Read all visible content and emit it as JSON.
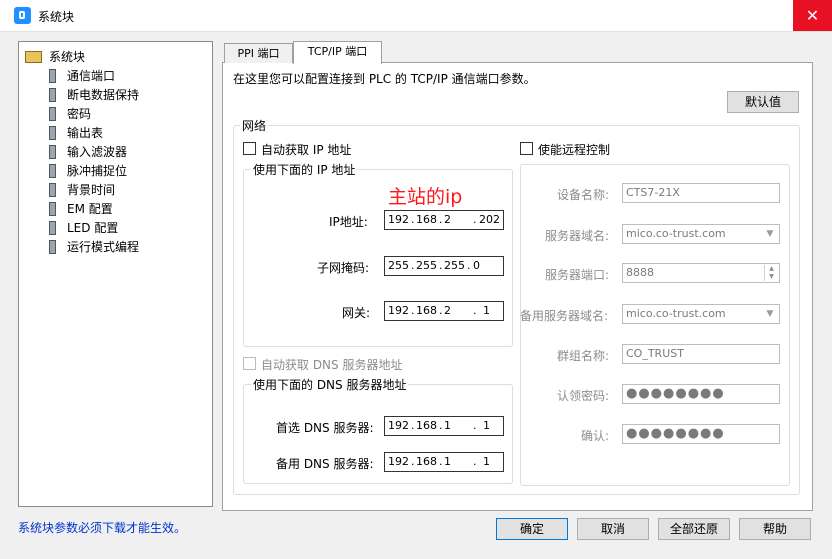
{
  "window": {
    "title": "系统块",
    "close_glyph": "✕"
  },
  "tree": {
    "root": "系统块",
    "items": [
      "通信端口",
      "断电数据保持",
      "密码",
      "输出表",
      "输入滤波器",
      "脉冲捕捉位",
      "背景时间",
      "EM 配置",
      "LED 配置",
      "运行模式编程"
    ]
  },
  "tabs": [
    {
      "label": "PPI 端口"
    },
    {
      "label": "TCP/IP 端口"
    }
  ],
  "intro": "在这里您可以配置连接到 PLC 的 TCP/IP 通信端口参数。",
  "default_button": "默认值",
  "network": {
    "title": "网络",
    "auto_ip_label": "自动获取 IP 地址",
    "use_ip_title": "使用下面的 IP 地址",
    "annotation": "主站的ip",
    "ip_label": "IP地址:",
    "ip": [
      "192",
      "168",
      "2",
      "202"
    ],
    "subnet_label": "子网掩码:",
    "subnet": [
      "255",
      "255",
      "255",
      "0"
    ],
    "gateway_label": "网关:",
    "gateway": [
      "192",
      "168",
      "2",
      "1"
    ],
    "auto_dns_label": "自动获取 DNS 服务器地址",
    "use_dns_title": "使用下面的 DNS 服务器地址",
    "dns1_label": "首选 DNS 服务器:",
    "dns1": [
      "192",
      "168",
      "1",
      "1"
    ],
    "dns2_label": "备用 DNS 服务器:",
    "dns2": [
      "192",
      "168",
      "1",
      "1"
    ]
  },
  "remote": {
    "enable_label": "使能远程控制",
    "device_name_label": "设备名称:",
    "device_name": "CTS7-21X",
    "server_domain_label": "服务器域名:",
    "server_domain": "mico.co-trust.com",
    "server_port_label": "服务器端口:",
    "server_port": "8888",
    "backup_domain_label": "备用服务器域名:",
    "backup_domain": "mico.co-trust.com",
    "group_name_label": "群组名称:",
    "group_name": "CO_TRUST",
    "auth_password_label": "认领密码:",
    "auth_password": "●●●●●●●●",
    "confirm_label": "确认:",
    "confirm_password": "●●●●●●●●"
  },
  "status_note": "系统块参数必须下载才能生效。",
  "buttons": {
    "ok": "确定",
    "cancel": "取消",
    "restore_all": "全部还原",
    "help": "帮助"
  }
}
